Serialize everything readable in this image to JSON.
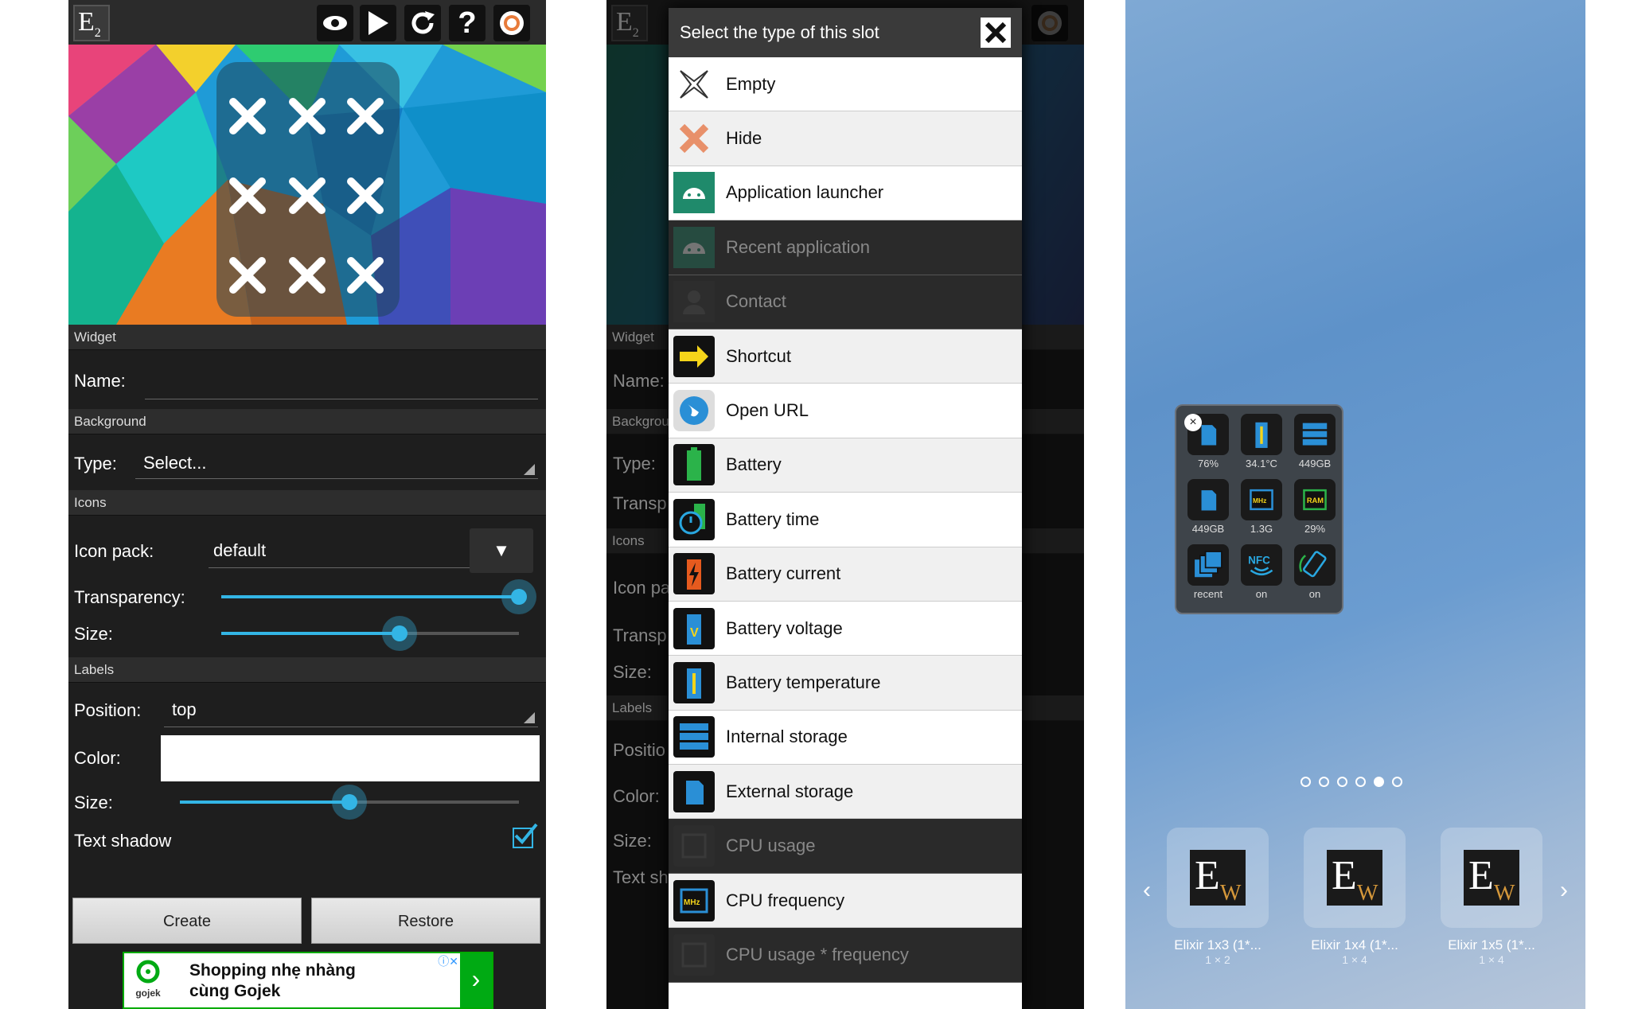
{
  "panel1": {
    "logo": "E",
    "logo_sub": "2",
    "toolbar_icons": [
      "eye-icon",
      "play-icon",
      "redo-icon",
      "help-icon",
      "record-icon"
    ],
    "sections": {
      "widget": "Widget",
      "background": "Background",
      "icons": "Icons",
      "labels": "Labels"
    },
    "name_label": "Name:",
    "name_value": "",
    "type_label": "Type:",
    "type_value": "Select...",
    "icon_pack_label": "Icon pack:",
    "icon_pack_value": "default",
    "transparency_label": "Transparency:",
    "transparency_value": 1.0,
    "icon_size_label": "Size:",
    "icon_size_value": 0.6,
    "position_label": "Position:",
    "position_value": "top",
    "color_label": "Color:",
    "color_value": "#ffffff",
    "label_size_label": "Size:",
    "label_size_value": 0.5,
    "text_shadow_label": "Text shadow",
    "text_shadow_checked": true,
    "create_label": "Create",
    "restore_label": "Restore",
    "ad": {
      "brand": "gojek",
      "line1": "Shopping nhẹ nhàng",
      "line2": "cùng Gojek"
    }
  },
  "panel2": {
    "dialog_title": "Select the type of this slot",
    "items": [
      {
        "label": "Empty",
        "icon": "x-outline-icon",
        "state": "enabled"
      },
      {
        "label": "Hide",
        "icon": "x-orange-icon",
        "state": "enabled"
      },
      {
        "label": "Application launcher",
        "icon": "android-icon",
        "state": "enabled"
      },
      {
        "label": "Recent application",
        "icon": "android-icon",
        "state": "disabled"
      },
      {
        "label": "Contact",
        "icon": "contact-icon",
        "state": "disabled"
      },
      {
        "label": "Shortcut",
        "icon": "shortcut-arrow-icon",
        "state": "enabled"
      },
      {
        "label": "Open URL",
        "icon": "globe-icon",
        "state": "enabled"
      },
      {
        "label": "Battery",
        "icon": "battery-icon",
        "state": "enabled"
      },
      {
        "label": "Battery time",
        "icon": "battery-time-icon",
        "state": "enabled"
      },
      {
        "label": "Battery current",
        "icon": "battery-current-icon",
        "state": "enabled"
      },
      {
        "label": "Battery voltage",
        "icon": "battery-voltage-icon",
        "state": "enabled"
      },
      {
        "label": "Battery temperature",
        "icon": "battery-temperature-icon",
        "state": "enabled"
      },
      {
        "label": "Internal storage",
        "icon": "internal-storage-icon",
        "state": "enabled"
      },
      {
        "label": "External storage",
        "icon": "sd-card-icon",
        "state": "enabled"
      },
      {
        "label": "CPU usage",
        "icon": "cpu-icon",
        "state": "disabled"
      },
      {
        "label": "CPU frequency",
        "icon": "cpu-mhz-icon",
        "state": "enabled"
      },
      {
        "label": "CPU usage * frequency",
        "icon": "cpu-icon",
        "state": "disabled"
      }
    ],
    "bg_labels": {
      "widget": "Widget",
      "name": "Name:",
      "background": "Backgrou",
      "type": "Type:",
      "transp": "Transp",
      "icons": "Icons",
      "icon_pack": "Icon pa",
      "transp2": "Transp",
      "size": "Size:",
      "labels": "Labels",
      "position": "Positio",
      "color": "Color:",
      "size2": "Size:",
      "text_shadow": "Text sh"
    }
  },
  "panel3": {
    "widget_cells": [
      {
        "label": "76%",
        "icon": "sd-card-icon"
      },
      {
        "label": "34.1°C",
        "icon": "battery-temperature-icon"
      },
      {
        "label": "449GB",
        "icon": "internal-storage-icon"
      },
      {
        "label": "449GB",
        "icon": "sd-card-icon"
      },
      {
        "label": "1.3G",
        "icon": "cpu-mhz-icon"
      },
      {
        "label": "29%",
        "icon": "ram-icon"
      },
      {
        "label": "recent",
        "icon": "recent-apps-icon"
      },
      {
        "label": "on",
        "icon": "nfc-icon"
      },
      {
        "label": "on",
        "icon": "rotate-icon"
      }
    ],
    "close_glyph": "×",
    "page_dots": 6,
    "active_dot": 4,
    "widget_picker": [
      {
        "name": "Elixir 1x3 (1*...",
        "size": "1 × 2"
      },
      {
        "name": "Elixir 1x4 (1*...",
        "size": "1 × 4"
      },
      {
        "name": "Elixir 1x5 (1*...",
        "size": "1 × 4"
      }
    ],
    "nfc_text": "NFC",
    "mhz_text": "MHz",
    "ram_text": "RAM",
    "picker_logo": "E",
    "picker_logo_sub": "W"
  }
}
